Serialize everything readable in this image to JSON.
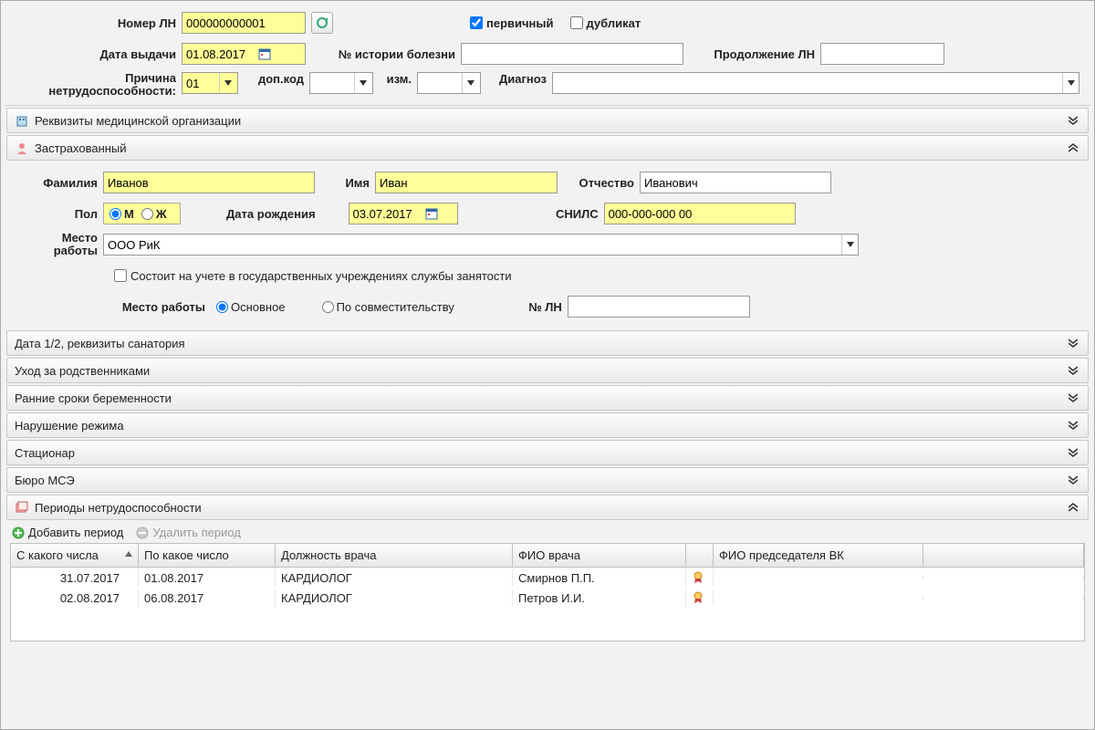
{
  "header": {
    "ln_number_label": "Номер ЛН",
    "ln_number": "000000000001",
    "primary_label": "первичный",
    "duplicate_label": "дубликат",
    "issue_date_label": "Дата выдачи",
    "issue_date": "01.08.2017",
    "history_no_label": "№ истории болезни",
    "history_no": "",
    "continuation_label": "Продолжение ЛН",
    "continuation": "",
    "disability_reason_label_1": "Причина",
    "disability_reason_label_2": "нетрудоспособности:",
    "reason_code": "01",
    "add_code_label": "доп.код",
    "add_code": "",
    "chg_label": "изм.",
    "chg": "",
    "diagnosis_label": "Диагноз",
    "diagnosis": ""
  },
  "sections": {
    "org": "Реквизиты медицинской организации",
    "insured": "Застрахованный",
    "date12": "Дата 1/2, реквизиты санатория",
    "care": "Уход за родственниками",
    "pregnancy": "Ранние сроки беременности",
    "violation": "Нарушение режима",
    "hospital": "Стационар",
    "mse": "Бюро МСЭ",
    "periods": "Периоды нетрудоспособности"
  },
  "insured": {
    "lastname_label": "Фамилия",
    "lastname": "Иванов",
    "firstname_label": "Имя",
    "firstname": "Иван",
    "patronymic_label": "Отчество",
    "patronymic": "Иванович",
    "gender_label": "Пол",
    "gender_m": "М",
    "gender_f": "Ж",
    "birthdate_label": "Дата рождения",
    "birthdate": "03.07.2017",
    "snils_label": "СНИЛС",
    "snils": "000-000-000 00",
    "workplace_label": "Место",
    "workplace_label2": "работы",
    "workplace": "ООО РиК",
    "employment_reg_label": "Состоит на учете в государственных учреждениях службы занятости",
    "worktype_label": "Место работы",
    "worktype_main": "Основное",
    "worktype_part": "По совместительству",
    "ln_no_label": "№ ЛН",
    "ln_no": ""
  },
  "periods": {
    "add_label": "Добавить период",
    "del_label": "Удалить период",
    "columns": {
      "from": "С какого числа",
      "to": "По какое число",
      "position": "Должность врача",
      "doctor": "ФИО врача",
      "chair": "ФИО председателя ВК"
    },
    "rows": [
      {
        "from": "31.07.2017",
        "to": "01.08.2017",
        "position": "КАРДИОЛОГ",
        "doctor": "Смирнов П.П.",
        "chair": ""
      },
      {
        "from": "02.08.2017",
        "to": "06.08.2017",
        "position": "КАРДИОЛОГ",
        "doctor": "Петров И.И.",
        "chair": ""
      }
    ]
  }
}
